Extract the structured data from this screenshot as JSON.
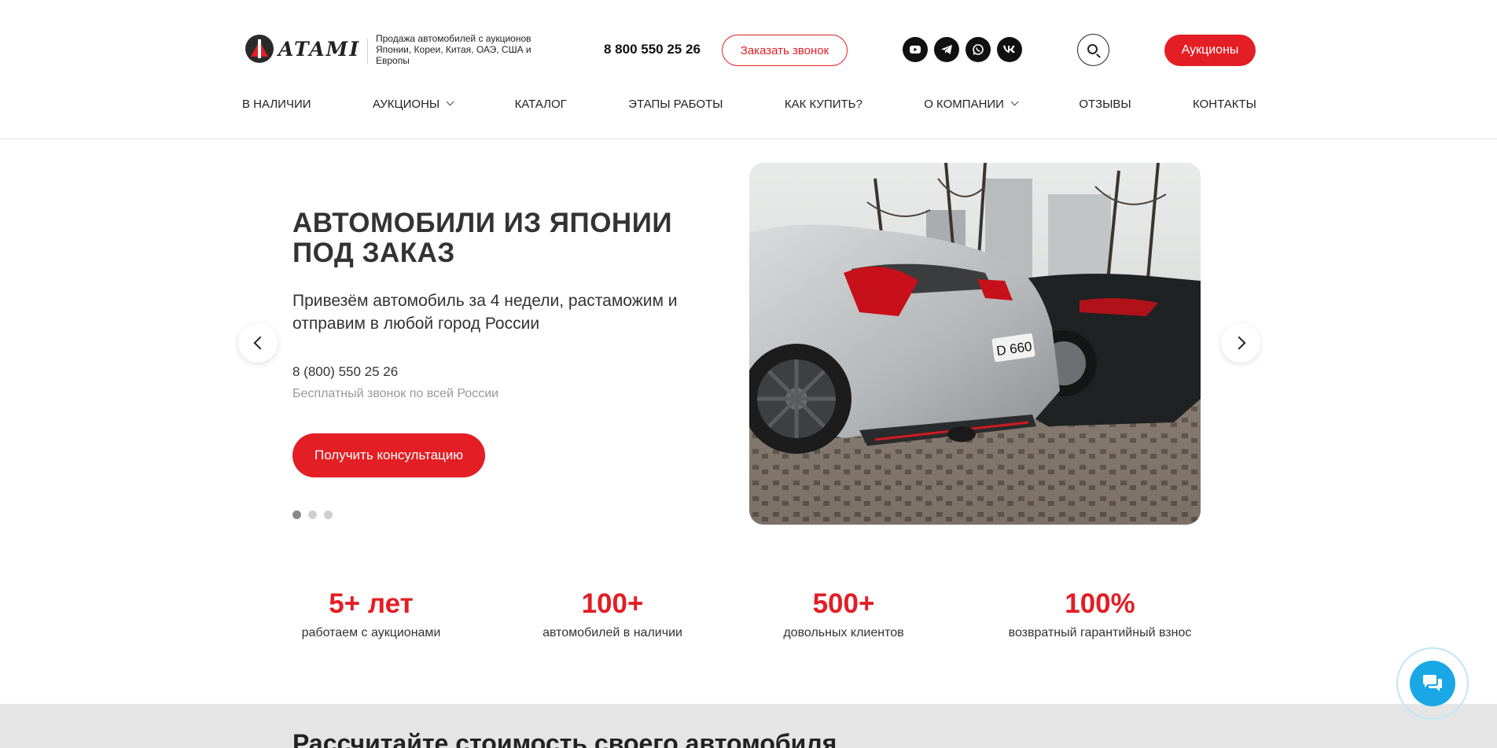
{
  "header": {
    "logo_text": "ATAMI",
    "tagline": "Продажа автомобилей с аукционов Японии, Кореи, Китая, ОАЭ, США и Европы",
    "phone": "8 800 550 25 26",
    "callback_label": "Заказать звонок",
    "socials": [
      "youtube-icon",
      "telegram-icon",
      "whatsapp-icon",
      "vk-icon"
    ],
    "auctions_label": "Аукционы"
  },
  "nav": {
    "items": [
      {
        "label": "В НАЛИЧИИ",
        "has_dropdown": false
      },
      {
        "label": "АУКЦИОНЫ",
        "has_dropdown": true
      },
      {
        "label": "КАТАЛОГ",
        "has_dropdown": false
      },
      {
        "label": "ЭТАПЫ РАБОТЫ",
        "has_dropdown": false
      },
      {
        "label": "КАК КУПИТЬ?",
        "has_dropdown": false
      },
      {
        "label": "О КОМПАНИИ",
        "has_dropdown": true
      },
      {
        "label": "ОТЗЫВЫ",
        "has_dropdown": false
      },
      {
        "label": "КОНТАКТЫ",
        "has_dropdown": false
      }
    ]
  },
  "hero": {
    "title_line1": "АВТОМОБИЛИ ИЗ ЯПОНИИ",
    "title_line2": "ПОД ЗАКАЗ",
    "subtitle": "Привезём автомобиль за 4 недели, растаможим и отправим в любой город России",
    "phone": "8 (800) 550 25 26",
    "phone_note": "Бесплатный звонок по всей России",
    "cta_label": "Получить консультацию",
    "slides_total": 3,
    "active_slide": 1,
    "plate_text": "D 660"
  },
  "stats": [
    {
      "value": "5+ лет",
      "label": "работаем с аукционами"
    },
    {
      "value": "100+",
      "label": "автомобилей в наличии"
    },
    {
      "value": "500+",
      "label": "довольных клиентов"
    },
    {
      "value": "100%",
      "label": "возвратный гарантийный взнос"
    }
  ],
  "calculator": {
    "title": "Рассчитайте стоимость своего автомобиля"
  },
  "colors": {
    "accent": "#e31e24",
    "chat": "#1aa7e6"
  }
}
